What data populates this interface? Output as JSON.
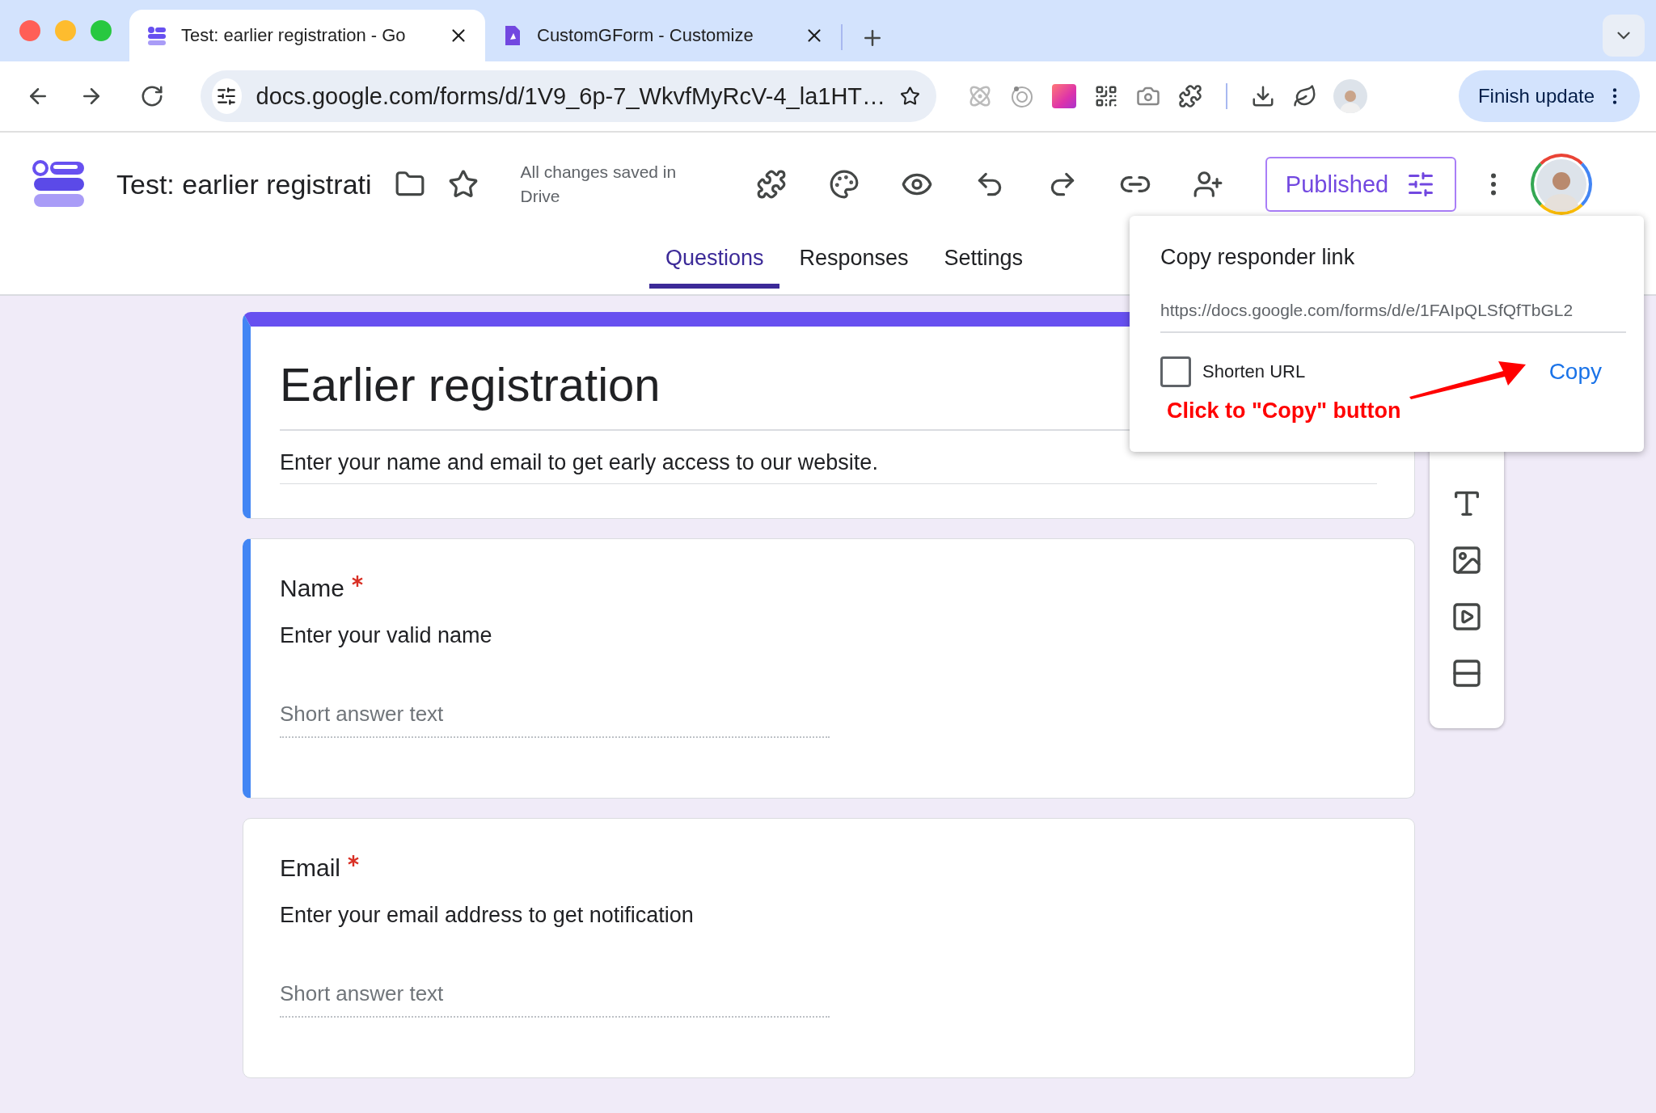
{
  "browser": {
    "tabs": [
      {
        "title": "Test: earlier registration - Go",
        "selected": true
      },
      {
        "title": "CustomGForm - Customize",
        "selected": false
      }
    ],
    "address": "docs.google.com/forms/d/1V9_6p-7_WkvfMyRcV-4_la1HT…",
    "update_button": "Finish update"
  },
  "header": {
    "title": "Test: earlier registrati",
    "save_status": "All changes saved in Drive",
    "publish_button": "Published"
  },
  "tabs": [
    {
      "label": "Questions",
      "selected": true
    },
    {
      "label": "Responses",
      "selected": false
    },
    {
      "label": "Settings",
      "selected": false
    }
  ],
  "form": {
    "title": "Earlier registration",
    "description": "Enter your name and email to get early access to our website.",
    "questions": [
      {
        "title": "Name",
        "required": true,
        "description": "Enter your valid name",
        "placeholder": "Short answer text"
      },
      {
        "title": "Email",
        "required": true,
        "description": "Enter your email address to get notification",
        "placeholder": "Short answer text"
      }
    ]
  },
  "popup": {
    "title": "Copy responder link",
    "link": "https://docs.google.com/forms/d/e/1FAIpQLSfQfTbGL2",
    "shorten_url": {
      "label": "Shorten URL",
      "checked": false
    },
    "copy_button": "Copy",
    "annotation": "Click to \"Copy\" button"
  }
}
